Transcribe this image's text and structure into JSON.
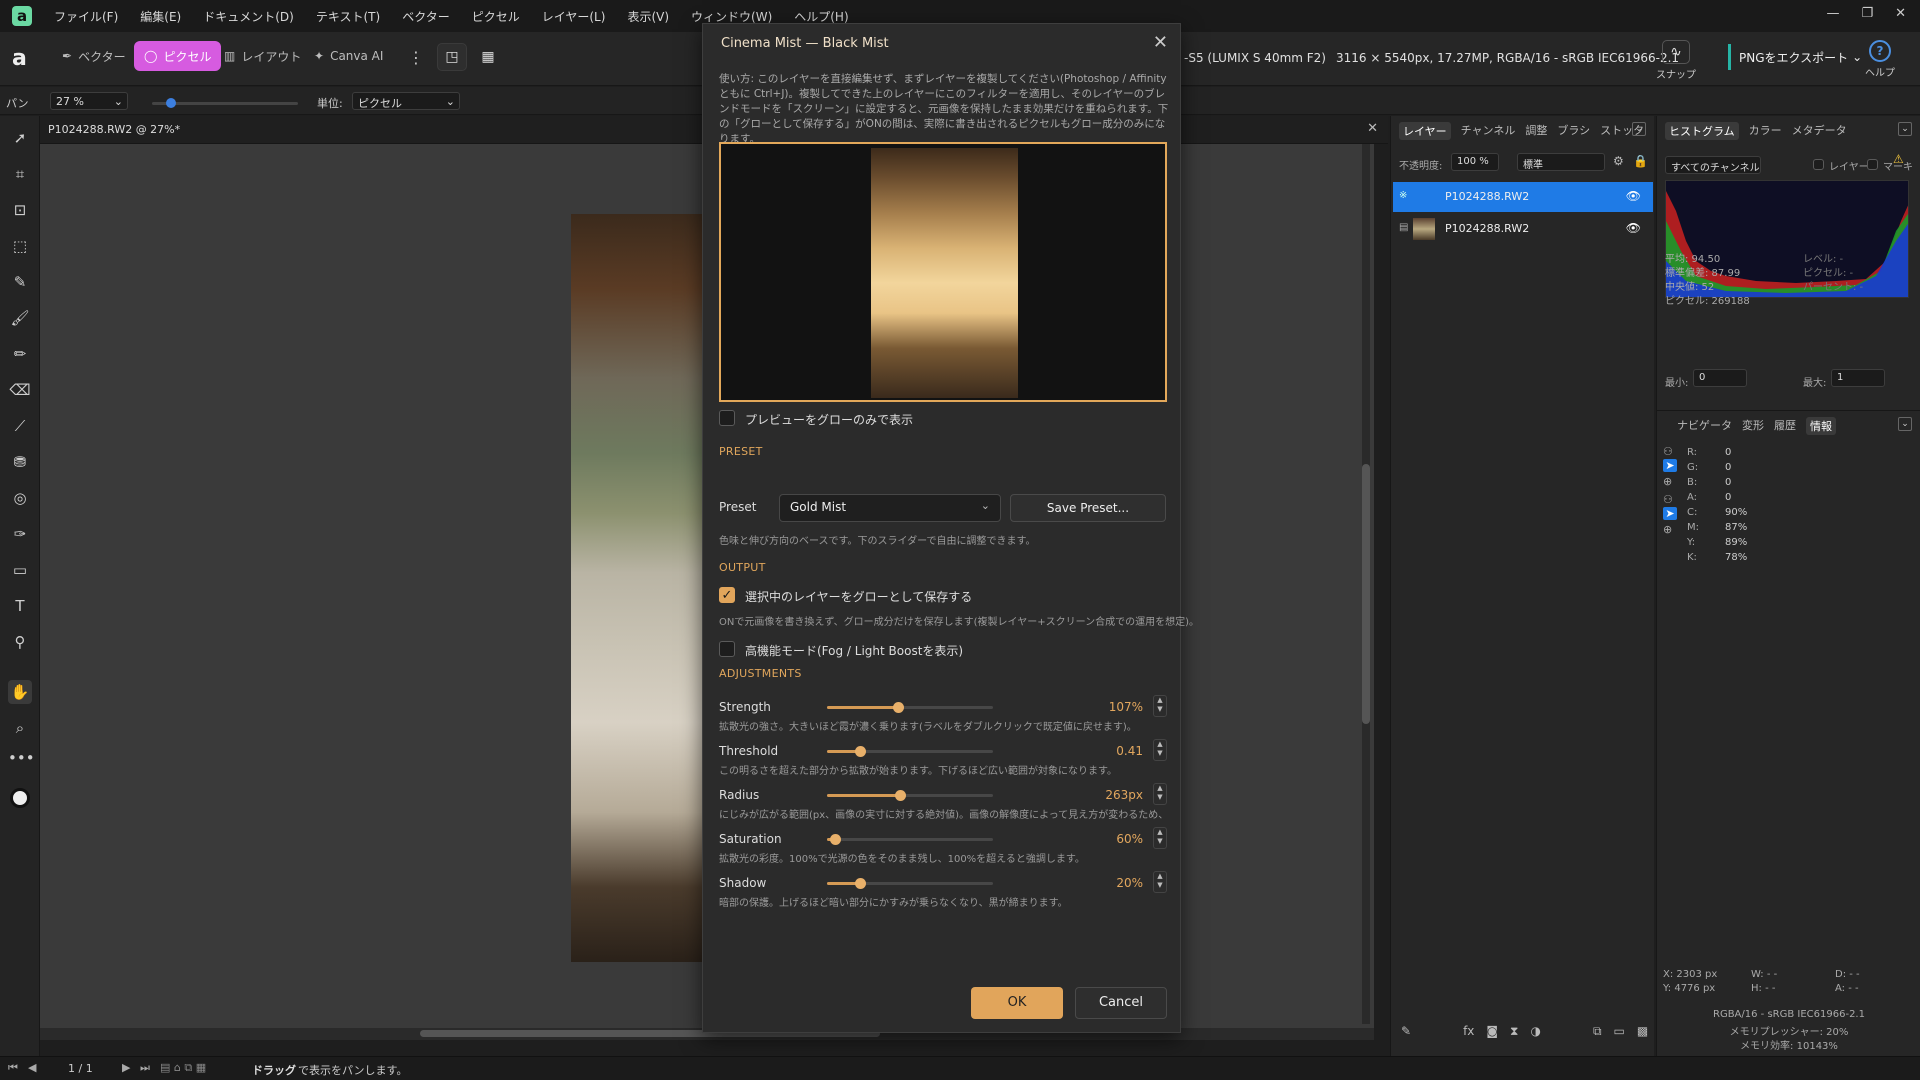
{
  "app": {
    "logo": "a"
  },
  "menu": [
    "ファイル(F)",
    "編集(E)",
    "ドキュメント(D)",
    "テキスト(T)",
    "ベクター",
    "ピクセル",
    "レイヤー(L)",
    "表示(V)",
    "ウィンドウ(W)",
    "ヘルプ(H)"
  ],
  "toolbar": {
    "personas": [
      "ベクター",
      "ピクセル",
      "レイアウト",
      "Canva AI"
    ],
    "camera": "-S5 (LUMIX S 40mm F2)",
    "docinfo": "3116 × 5540px, 17.27MP, RGBA/16 - sRGB IEC61966-2.1",
    "snap": "スナップ",
    "export": "PNGをエクスポート",
    "help": "ヘルプ"
  },
  "context": {
    "tool": "パン",
    "zoom": "27 %",
    "unit_label": "単位:",
    "unit": "ピクセル"
  },
  "document": {
    "tab": "P1024288.RW2 @ 27%*"
  },
  "dialog": {
    "title": "Cinema Mist — Black Mist",
    "howto": "使い方: このレイヤーを直接編集せず、まずレイヤーを複製してください(Photoshop / Affinityともに Ctrl+J)。複製してできた上のレイヤーにこのフィルターを適用し、そのレイヤーのブレンドモードを「スクリーン」に設定すると、元画像を保持したまま効果だけを重ねられます。下の「グローとして保存する」がONの間は、実際に書き出されるピクセルもグロー成分のみになります。",
    "glow_only_label": "プレビューをグローのみで表示",
    "preset_section": "PRESET",
    "preset_label": "Preset",
    "preset_value": "Gold Mist",
    "save_preset": "Save Preset...",
    "preset_hint": "色味と伸び方向のベースです。下のスライダーで自由に調整できます。",
    "output_section": "OUTPUT",
    "save_glow_label": "選択中のレイヤーをグローとして保存する",
    "save_glow_hint": "ONで元画像を書き換えず、グロー成分だけを保存します(複製レイヤー+スクリーン合成での運用を想定)。",
    "advanced_label": "高機能モード(Fog / Light Boostを表示)",
    "adjust_section": "ADJUSTMENTS",
    "adjustments": [
      {
        "label": "Strength",
        "value": "107%",
        "level": 0.43,
        "hint": "拡散光の強さ。大きいほど霞が濃く乗ります(ラベルをダブルクリックで既定値に戻せます)。"
      },
      {
        "label": "Threshold",
        "value": "0.41",
        "level": 0.2,
        "hint": "この明るさを超えた部分から拡散が始まります。下げるほど広い範囲が対象になります。"
      },
      {
        "label": "Radius",
        "value": "263px",
        "level": 0.44,
        "hint": "にじみが広がる範囲(px、画像の実寸に対する絶対値)。画像の解像度によって見え方が変わるため、画像"
      },
      {
        "label": "Saturation",
        "value": "60%",
        "level": 0.05,
        "hint": "拡散光の彩度。100%で光源の色をそのまま残し、100%を超えると強調します。"
      },
      {
        "label": "Shadow",
        "value": "20%",
        "level": 0.2,
        "hint": "暗部の保護。上げるほど暗い部分にかすみが乗らなくなり、黒が締まります。"
      }
    ],
    "ok": "OK",
    "cancel": "Cancel",
    "accent": "#e1a55b"
  },
  "layers_panel": {
    "tabs": [
      "レイヤー",
      "チャンネル",
      "調整",
      "ブラシ",
      "ストック"
    ],
    "opacity_label": "不透明度:",
    "opacity": "100 %",
    "blend": "標準",
    "layers": [
      {
        "name": "P1024288.RW2",
        "selected": true
      },
      {
        "name": "P1024288.RW2",
        "selected": false
      }
    ]
  },
  "histogram_panel": {
    "tabs": [
      "ヒストグラム",
      "カラー",
      "メタデータ"
    ],
    "channel": "すべてのチャンネル",
    "chk_layer": "レイヤー",
    "chk_marquee": "マーキー",
    "stats": [
      "平均: 94.50",
      "標準偏差: 87.99",
      "中央値: 52",
      "ピクセル: 269188"
    ],
    "stats_right": [
      "レベル: -",
      "ピクセル: -",
      "パーセント: -"
    ],
    "min_label": "最小:",
    "min": "0",
    "max_label": "最大:",
    "max": "1"
  },
  "info_panel": {
    "tabs": [
      "ナビゲータ",
      "変形",
      "履歴",
      "情報"
    ],
    "rgba": [
      [
        "R:",
        "0"
      ],
      [
        "G:",
        "0"
      ],
      [
        "B:",
        "0"
      ],
      [
        "A:",
        "0"
      ]
    ],
    "cmyk": [
      [
        "C:",
        "90%"
      ],
      [
        "M:",
        "87%"
      ],
      [
        "Y:",
        "89%"
      ],
      [
        "K:",
        "78%"
      ]
    ],
    "xy": [
      "X: 2303 px",
      "Y: 4776 px"
    ],
    "wh": [
      "W: - -",
      "H: - -"
    ],
    "da": [
      "D: - -",
      "A: - -"
    ],
    "footer": [
      "RGBA/16 - sRGB IEC61966-2.1",
      "メモリプレッシャー: 20%",
      "メモリ効率: 10143%"
    ]
  },
  "status": {
    "page": "1 / 1",
    "hint_bold": "ドラッグ",
    "hint": "で表示をパンします。"
  }
}
